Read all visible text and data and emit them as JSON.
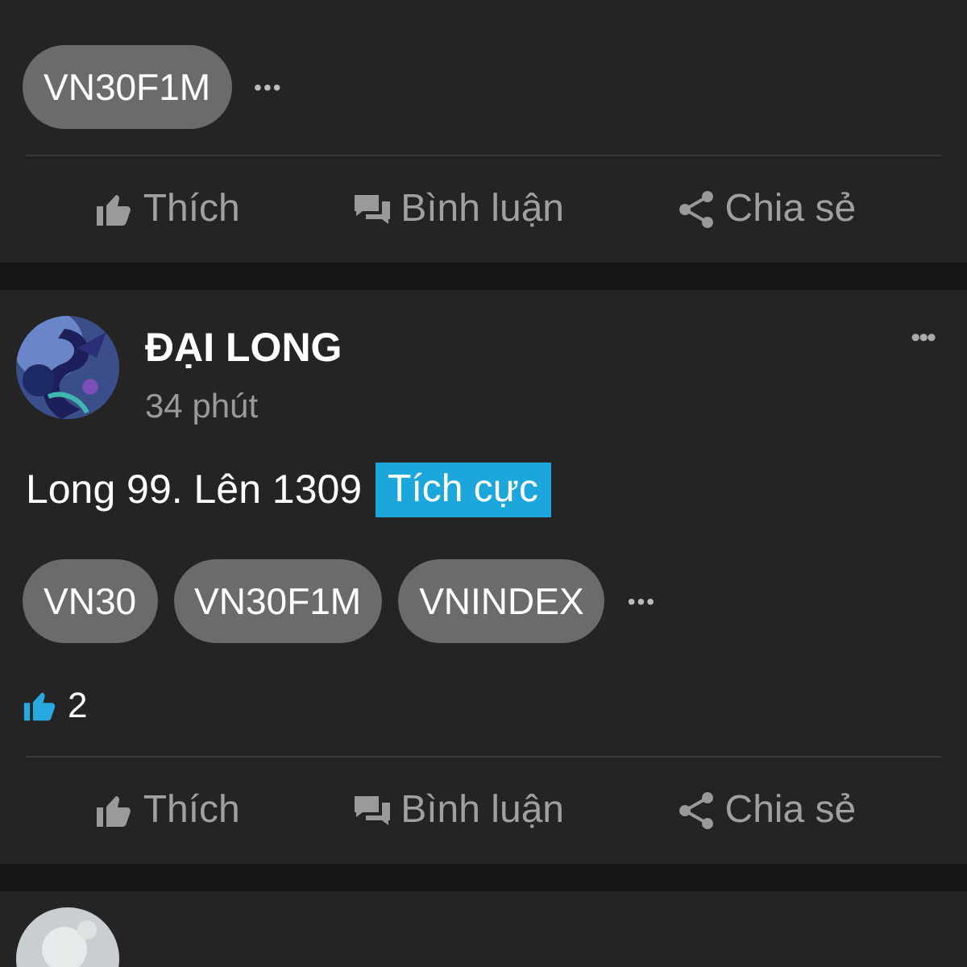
{
  "posts": [
    {
      "tags": [
        "VN30F1M"
      ],
      "more_tags": "•••",
      "actions": [
        {
          "kind": "like",
          "label": "Thích"
        },
        {
          "kind": "comment",
          "label": "Bình luận"
        },
        {
          "kind": "share",
          "label": "Chia sẻ"
        }
      ]
    },
    {
      "avatar": {
        "kind": "picture"
      },
      "author": "ĐẠI LONG",
      "time": "34 phút",
      "menu": "•••",
      "body": "Long 99. Lên 1309",
      "sentiment": "Tích cực",
      "tags": [
        "VN30",
        "VN30F1M",
        "VNINDEX"
      ],
      "more_tags": "•••",
      "like_count": "2",
      "actions": [
        {
          "kind": "like",
          "label": "Thích"
        },
        {
          "kind": "comment",
          "label": "Bình luận"
        },
        {
          "kind": "share",
          "label": "Chia sẻ"
        }
      ]
    },
    {
      "avatar": {
        "kind": "picture"
      }
    }
  ]
}
